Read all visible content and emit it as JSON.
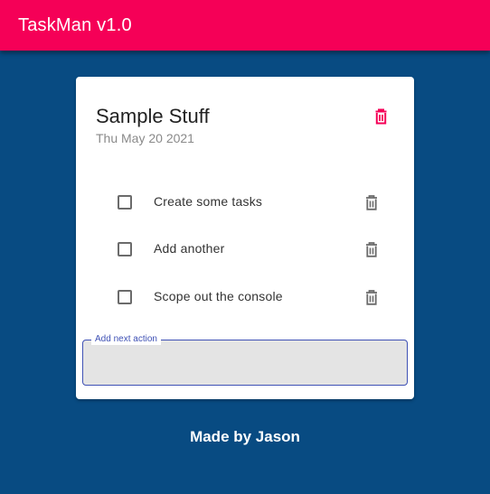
{
  "app": {
    "title": "TaskMan v1.0"
  },
  "card": {
    "title": "Sample Stuff",
    "date": "Thu May 20 2021",
    "delete_icon": "trash-icon",
    "tasks": [
      {
        "label": "Create some tasks",
        "checked": false
      },
      {
        "label": "Add another",
        "checked": false
      },
      {
        "label": "Scope out the console",
        "checked": false
      }
    ],
    "next_action": {
      "label": "Add next action",
      "value": ""
    }
  },
  "footer": {
    "text": "Made by Jason"
  },
  "colors": {
    "appbar": "#f50057",
    "background": "#084b82",
    "field_border": "#3f51b5",
    "icon_gray": "#6b6b6b"
  }
}
